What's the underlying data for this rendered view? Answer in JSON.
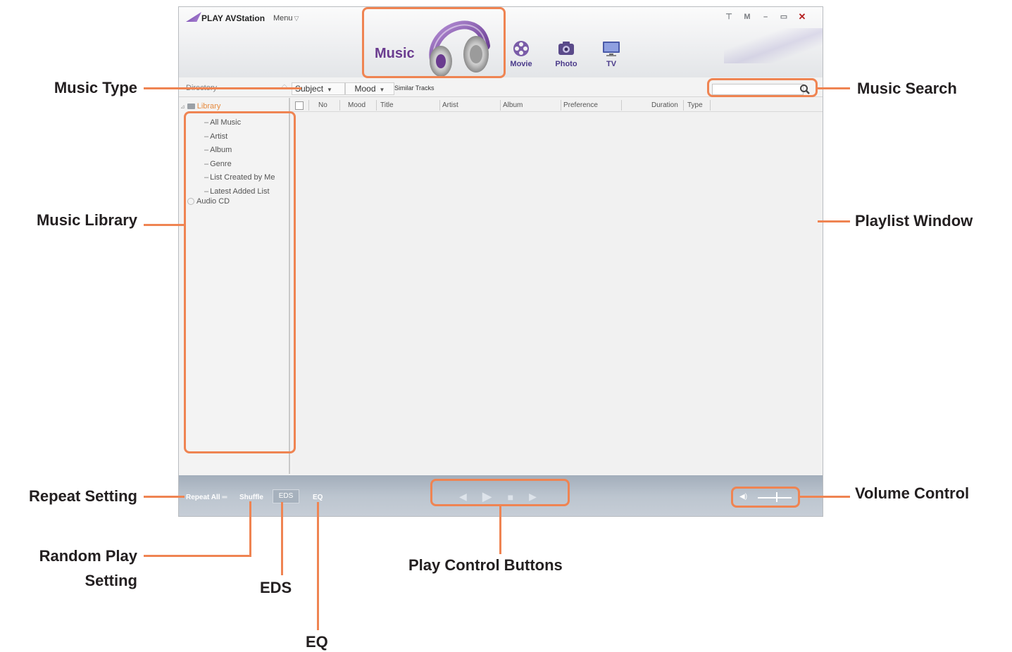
{
  "app": {
    "title": "PLAY AVStation",
    "menu_label": "Menu",
    "window_controls": [
      "pin-icon",
      "M",
      "minimize-icon",
      "restore-icon",
      "close-icon"
    ],
    "brand_color": "#6a3b8f",
    "accent_color": "#ef8452"
  },
  "tabs": {
    "active": "Music",
    "items": [
      {
        "label": "Movie",
        "icon": "film-reel-icon"
      },
      {
        "label": "Photo",
        "icon": "camera-icon"
      },
      {
        "label": "TV",
        "icon": "monitor-icon"
      }
    ]
  },
  "toolbar": {
    "directory_label": "Directory",
    "subject_filter": "Subject",
    "mood_filter": "Mood",
    "similar_tracks": "Similar Tracks",
    "search_value": "",
    "search_icon": "magnifier-icon"
  },
  "library": {
    "root": "Library",
    "items": [
      "All Music",
      "Artist",
      "Album",
      "Genre",
      "List Created by Me",
      "Latest Added List"
    ],
    "audio_cd": "Audio CD"
  },
  "playlist": {
    "columns": [
      "No",
      "Mood",
      "Title",
      "Artist",
      "Album",
      "Preference",
      "Duration",
      "Type"
    ],
    "rows": []
  },
  "bottom_bar": {
    "repeat": "Repeat All",
    "shuffle": "Shuffle",
    "eds": "EDS",
    "eq": "EQ",
    "play_controls": [
      "previous-icon",
      "play-icon",
      "stop-icon",
      "next-icon"
    ],
    "volume_icon": "speaker-icon",
    "volume_level": 0.55
  },
  "annotations": {
    "music_type": "Music Type",
    "music_library": "Music Library",
    "repeat_setting": "Repeat Setting",
    "random_play_line1": "Random Play",
    "random_play_line2": "Setting",
    "eds": "EDS",
    "eq": "EQ",
    "play_control_buttons": "Play Control Buttons",
    "music_search": "Music Search",
    "playlist_window": "Playlist Window",
    "volume_control": "Volume Control"
  }
}
